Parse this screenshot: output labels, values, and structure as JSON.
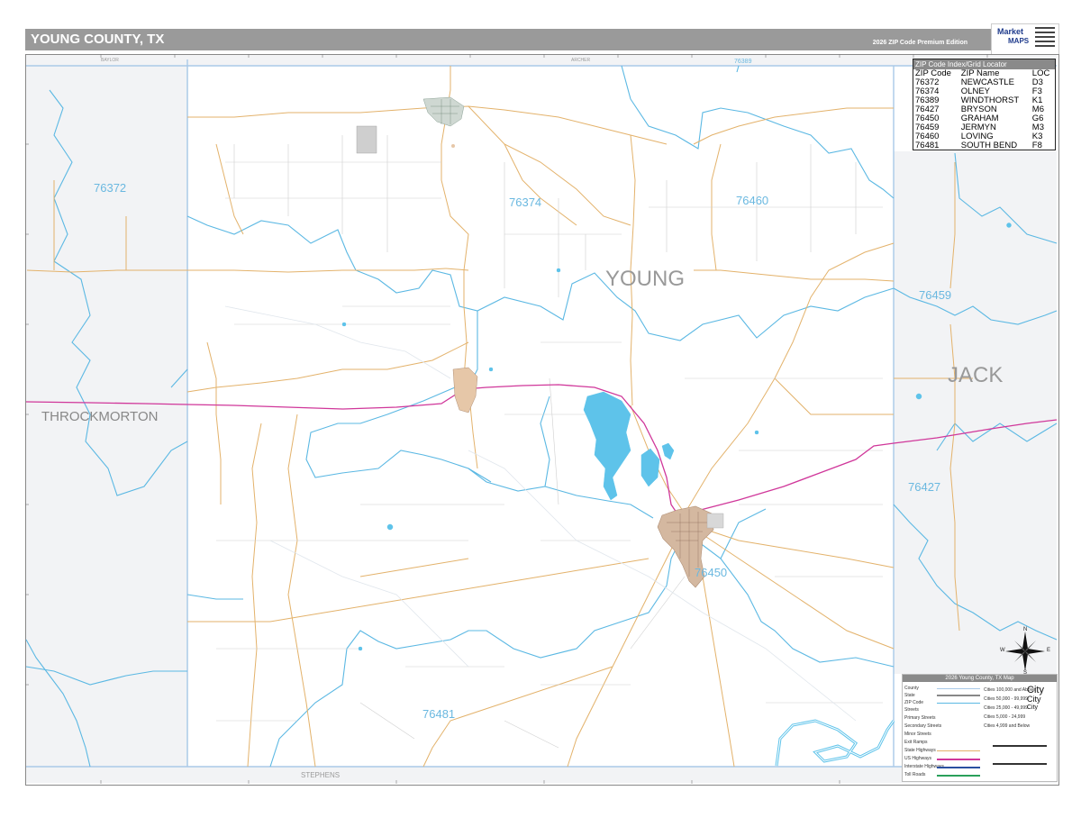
{
  "header": {
    "title": "YOUNG COUNTY, TX",
    "edition": "2026 ZIP Code Premium Edition"
  },
  "logo": {
    "line1": "Market",
    "line2": "MAPS"
  },
  "zip_index": {
    "header": "ZIP Code Index/Grid Locator",
    "columns": [
      "ZIP Code",
      "ZIP Name",
      "LOC"
    ],
    "rows": [
      [
        "76372",
        "NEWCASTLE",
        "D3"
      ],
      [
        "76374",
        "OLNEY",
        "F3"
      ],
      [
        "76389",
        "WINDTHORST",
        "K1"
      ],
      [
        "76427",
        "BRYSON",
        "M6"
      ],
      [
        "76450",
        "GRAHAM",
        "G6"
      ],
      [
        "76459",
        "JERMYN",
        "M3"
      ],
      [
        "76460",
        "LOVING",
        "K3"
      ],
      [
        "76481",
        "SOUTH BEND",
        "F8"
      ]
    ]
  },
  "map": {
    "county_labels": {
      "young": "YOUNG",
      "jack": "JACK",
      "throckmorton": "THROCKMORTON",
      "stephens": "STEPHENS",
      "archer": "ARCHER",
      "baylor": "BAYLOR"
    },
    "zip_labels": {
      "z76372": "76372",
      "z76374": "76374",
      "z76460": "76460",
      "z76459": "76459",
      "z76427": "76427",
      "z76450": "76450",
      "z76481": "76481",
      "z76389": "76389"
    },
    "colors": {
      "zip_boundary": "#5bb8e3",
      "county_boundary": "#a9c9e8",
      "state_highway": "#e3b26b",
      "us_highway": "#d0379a",
      "water": "#5ec3ea",
      "city_fill": "#d4b8a0",
      "neighbor_fill": "#f2f3f5"
    }
  },
  "legend": {
    "title": "2026 Young County, TX Map",
    "rows": [
      "County",
      "State",
      "ZIP Code",
      "Streets",
      "Primary Streets",
      "Secondary Streets",
      "Minor Streets",
      "Exit Ramps",
      "State Highways",
      "US Highways",
      "Interstate Highways",
      "Toll Roads"
    ],
    "cities": [
      "Cities 100,000 and Above",
      "Cities 50,000 - 99,999",
      "Cities 25,000 - 49,999",
      "Cities 5,000 - 24,999",
      "Cities 4,999 and Below"
    ],
    "city_samples": [
      "City",
      "City",
      "City"
    ]
  },
  "compass": {
    "n": "N",
    "e": "E",
    "s": "S",
    "w": "W"
  }
}
